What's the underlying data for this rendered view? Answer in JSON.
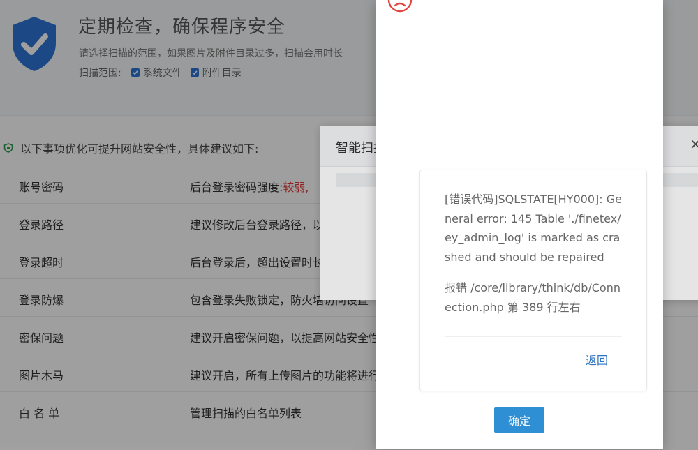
{
  "hero": {
    "title": "定期检查，确保程序安全",
    "description": "请选择扫描的范围，如果图片及附件目录过多，扫描会用时长",
    "scope_label": "扫描范围:",
    "options": [
      {
        "label": "系统文件",
        "checked": true
      },
      {
        "label": "附件目录",
        "checked": true
      }
    ]
  },
  "advice": {
    "text": "以下事项优化可提升网站安全性，具体建议如下:"
  },
  "items": [
    {
      "name": "账号密码",
      "desc": "后台登录密码强度:",
      "status": "较弱,"
    },
    {
      "name": "登录路径",
      "desc": "建议修改后台登录路径，以"
    },
    {
      "name": "登录超时",
      "desc": "后台登录后，超出设置时长"
    },
    {
      "name": "登录防爆",
      "desc": "包含登录失败锁定，防火墙访问设置"
    },
    {
      "name": "密保问题",
      "desc": "建议开启密保问题，以提高网站安全性"
    },
    {
      "name": "图片木马",
      "desc": "建议开启，所有上传图片的功能将进行"
    },
    {
      "name": "白 名 单",
      "desc": "管理扫描的白名单列表"
    }
  ],
  "scan_dialog": {
    "title": "智能扫描",
    "close": "×"
  },
  "error": {
    "message": "[错误代码]SQLSTATE[HY000]: General error: 145 Table './finetex/ey_admin_log' is marked as crashed and should be repaired",
    "location": "报错 /core/library/think/db/Connection.php 第 389 行左右",
    "back_label": "返回",
    "ok_label": "确定"
  },
  "colors": {
    "accent": "#2e8fd4",
    "shield": "#2e76d6",
    "danger": "#e23b3b",
    "link": "#2f74c0"
  }
}
